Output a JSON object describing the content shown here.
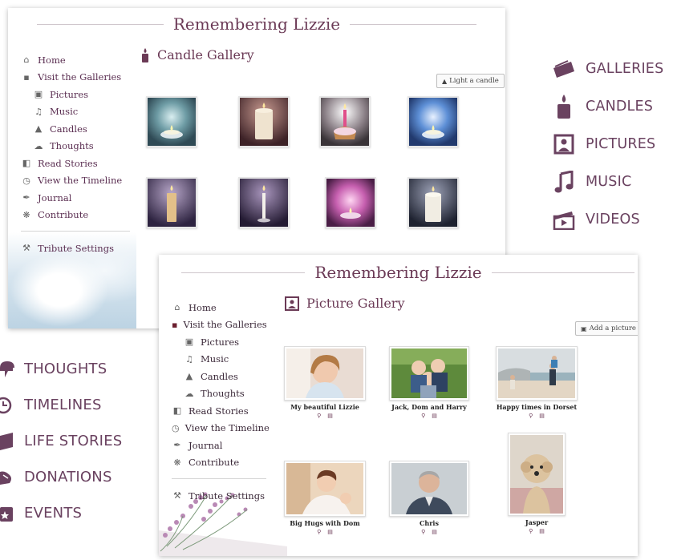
{
  "candle_page": {
    "header_title": "Remembering Lizzie",
    "gallery_title": "Candle Gallery",
    "action_button": "Light a candle",
    "nav": [
      {
        "label": "Home",
        "icon": "home-icon"
      },
      {
        "label": "Visit the Galleries",
        "icon": "gallery-icon"
      },
      {
        "label": "Pictures",
        "icon": "picture-icon"
      },
      {
        "label": "Music",
        "icon": "music-note-icon"
      },
      {
        "label": "Candles",
        "icon": "candle-icon"
      },
      {
        "label": "Thoughts",
        "icon": "thought-icon"
      },
      {
        "label": "Read Stories",
        "icon": "book-icon"
      },
      {
        "label": "View the Timeline",
        "icon": "clock-icon"
      },
      {
        "label": "Journal",
        "icon": "pen-icon"
      },
      {
        "label": "Contribute",
        "icon": "puzzle-icon"
      },
      {
        "label": "Tribute Settings",
        "icon": "wrench-icon"
      }
    ]
  },
  "picture_page": {
    "header_title": "Remembering Lizzie",
    "gallery_title": "Picture Gallery",
    "action_button": "Add a picture",
    "nav": [
      {
        "label": "Home",
        "icon": "home-icon"
      },
      {
        "label": "Visit the Galleries",
        "icon": "gallery-icon"
      },
      {
        "label": "Pictures",
        "icon": "picture-icon"
      },
      {
        "label": "Music",
        "icon": "music-note-icon"
      },
      {
        "label": "Candles",
        "icon": "candle-icon"
      },
      {
        "label": "Thoughts",
        "icon": "thought-icon"
      },
      {
        "label": "Read Stories",
        "icon": "book-icon"
      },
      {
        "label": "View the Timeline",
        "icon": "clock-icon"
      },
      {
        "label": "Journal",
        "icon": "pen-icon"
      },
      {
        "label": "Contribute",
        "icon": "puzzle-icon"
      },
      {
        "label": "Tribute Settings",
        "icon": "wrench-icon"
      }
    ],
    "pictures": [
      {
        "caption": "My beautiful Lizzie"
      },
      {
        "caption": "Jack, Dom and Harry"
      },
      {
        "caption": "Happy times in Dorset"
      },
      {
        "caption": "Big Hugs with Dom"
      },
      {
        "caption": "Chris"
      },
      {
        "caption": "Jasper"
      }
    ]
  },
  "features_right": [
    {
      "label": "GALLERIES",
      "icon": "gallery-icon"
    },
    {
      "label": "CANDLES",
      "icon": "candle-icon"
    },
    {
      "label": "PICTURES",
      "icon": "picture-icon"
    },
    {
      "label": "MUSIC",
      "icon": "music-note-icon"
    },
    {
      "label": "VIDEOS",
      "icon": "clapperboard-icon"
    }
  ],
  "features_left": [
    {
      "label": "THOUGHTS",
      "icon": "thought-icon"
    },
    {
      "label": "TIMELINES",
      "icon": "clock-icon"
    },
    {
      "label": "LIFE STORIES",
      "icon": "book-icon"
    },
    {
      "label": "DONATIONS",
      "icon": "heart-hand-icon"
    },
    {
      "label": "EVENTS",
      "icon": "star-calendar-icon"
    }
  ],
  "colors": {
    "accent_purple": "#6b3a56",
    "feature_text": "#6a4260",
    "nav_text": "#5b2f52"
  }
}
